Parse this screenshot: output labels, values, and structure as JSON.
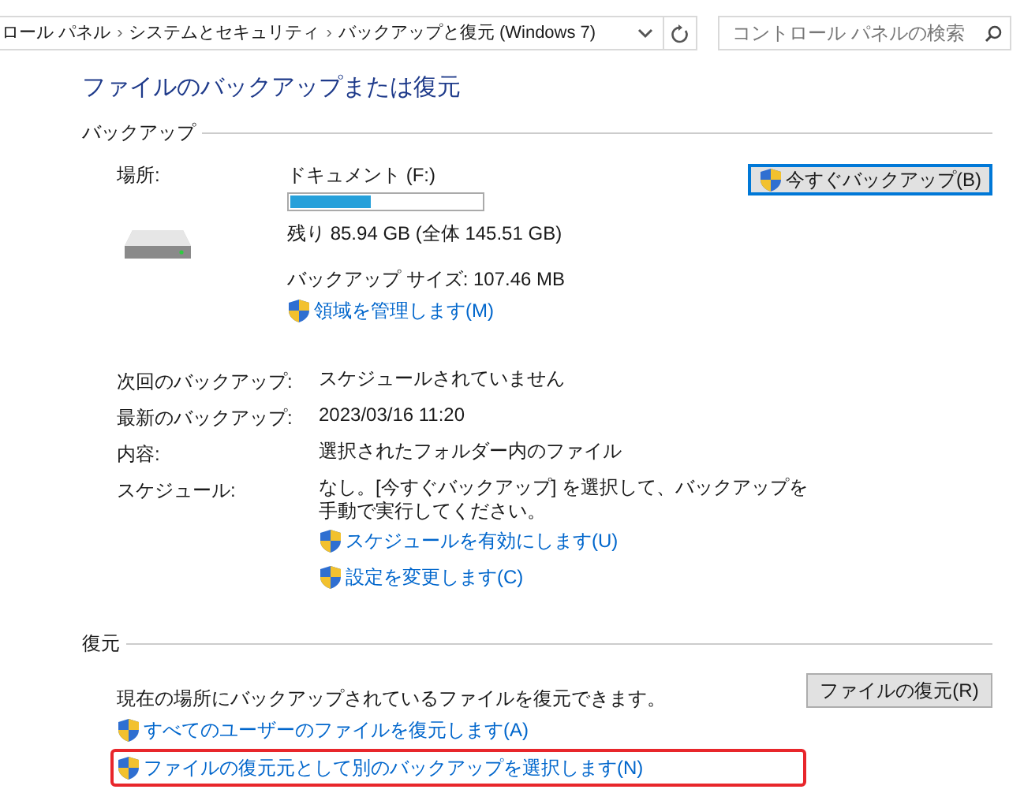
{
  "address_bar": {
    "breadcrumbs": [
      "ロール パネル",
      "システムとセキュリティ",
      "バックアップと復元 (Windows 7)"
    ],
    "separator": "›"
  },
  "search": {
    "placeholder": "コントロール パネルの検索"
  },
  "title": "ファイルのバックアップまたは復元",
  "backup": {
    "heading": "バックアップ",
    "location_label": "場所:",
    "drive_name": "ドキュメント (F:)",
    "level": 0.42,
    "free_space": "残り 85.94 GB (全体 145.51 GB)",
    "backup_size": "バックアップ サイズ: 107.46 MB",
    "manage_link": "領域を管理します(M)",
    "backup_button": "今すぐバックアップ(B)",
    "details": [
      {
        "label": "次回のバックアップ:",
        "value": "スケジュールされていません"
      },
      {
        "label": "最新のバックアップ:",
        "value": "2023/03/16 11:20"
      },
      {
        "label": "内容:",
        "value": "選択されたフォルダー内のファイル"
      },
      {
        "label": "スケジュール:",
        "value": "なし。[今すぐバックアップ] を選択して、バックアップを手動で実行してください。"
      }
    ],
    "links": [
      "スケジュールを有効にします(U)",
      "設定を変更します(C)"
    ]
  },
  "restore": {
    "heading": "復元",
    "description": "現在の場所にバックアップされているファイルを復元できます。",
    "restore_button": "ファイルの復元(R)",
    "links": [
      {
        "text": "すべてのユーザーのファイルを復元します(A)",
        "highlighted": false
      },
      {
        "text": "ファイルの復元元として別のバックアップを選択します(N)",
        "highlighted": true
      }
    ]
  }
}
